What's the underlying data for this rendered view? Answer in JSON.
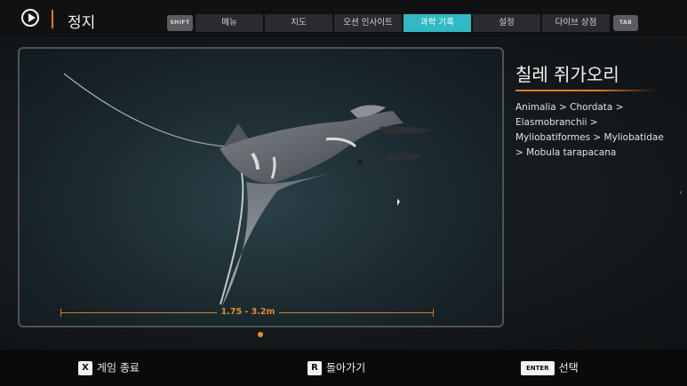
{
  "header": {
    "title": "정지",
    "shift_key": "SHIFT",
    "tab_key": "TAB",
    "tabs": [
      "메뉴",
      "지도",
      "오션 인사이트",
      "과학 기록",
      "설정",
      "다이브 상점"
    ],
    "active_tab_index": 3
  },
  "specimen": {
    "name": "칠레 쥐가오리",
    "taxonomy": "Animalia > Chordata > Elasmobranchii > Myliobatiformes > Myliobatidae > Mobula tarapacana",
    "size_range": "1.75 - 3.2m",
    "page_count": 1,
    "page_index": 0
  },
  "footer": {
    "quit": {
      "key": "X",
      "label": "게임 종료"
    },
    "back": {
      "key": "R",
      "label": "돌아가기"
    },
    "select": {
      "key": "ENTER",
      "label": "선택"
    }
  },
  "colors": {
    "accent": "#e07a1f",
    "tab_active": "#31b9c4"
  }
}
